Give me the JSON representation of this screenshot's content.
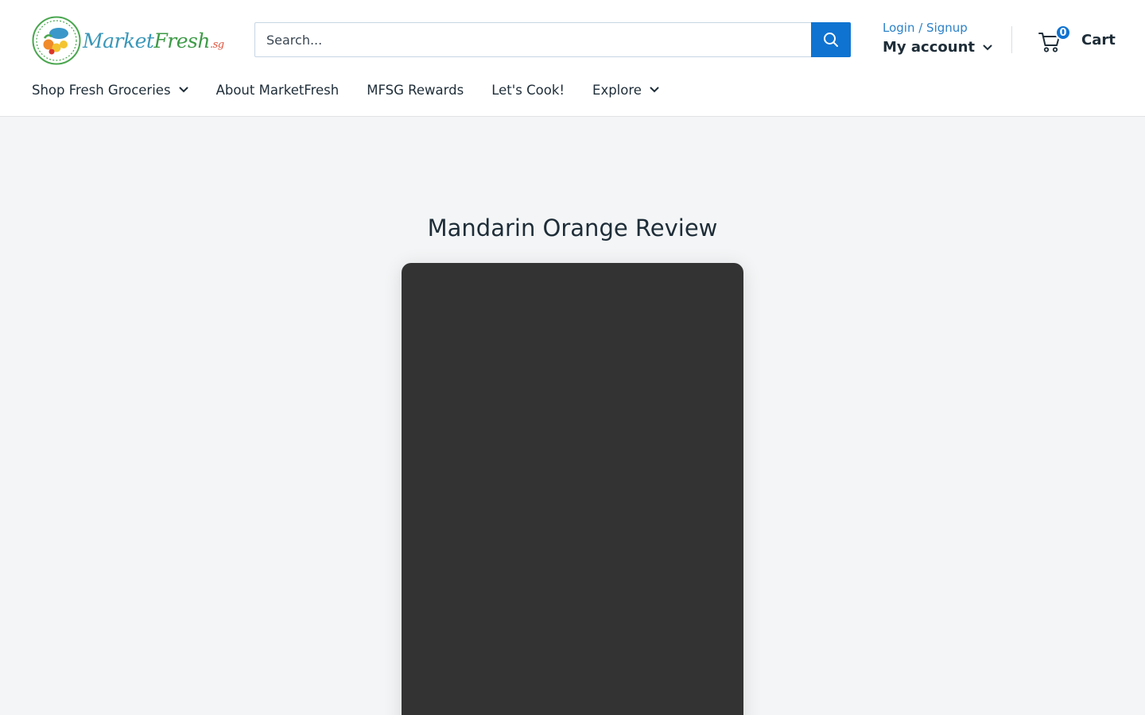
{
  "header": {
    "logo": {
      "part1": "Market",
      "part2": "Fresh",
      "part3": ".sg"
    },
    "search": {
      "placeholder": "Search..."
    },
    "account": {
      "login_link": "Login / Signup",
      "my_account": "My account"
    },
    "cart": {
      "count": "0",
      "label": "Cart"
    }
  },
  "nav": {
    "items": [
      {
        "label": "Shop Fresh Groceries"
      },
      {
        "label": "About MarketFresh"
      },
      {
        "label": "MFSG Rewards"
      },
      {
        "label": "Let's Cook!"
      },
      {
        "label": "Explore"
      }
    ]
  },
  "main": {
    "title": "Mandarin Orange Review"
  },
  "colors": {
    "accent": "#0f73d1",
    "link": "#2c82c9",
    "page_background": "#f3f5f6",
    "video_background": "#333333"
  }
}
